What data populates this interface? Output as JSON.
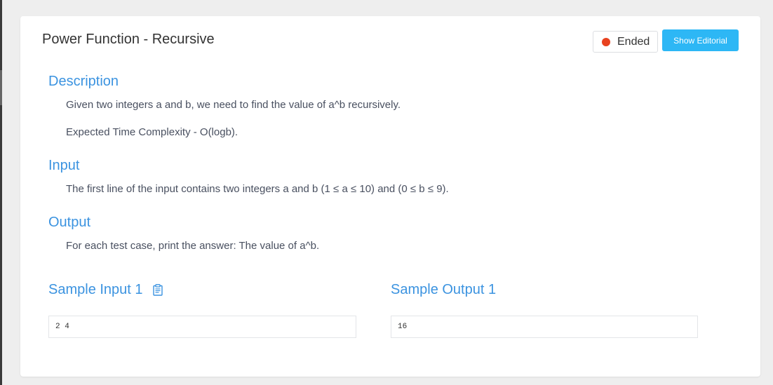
{
  "problem": {
    "title": "Power Function - Recursive",
    "status": {
      "label": "Ended",
      "color": "#e8421f"
    },
    "editorial_button": "Show Editorial"
  },
  "description": {
    "heading": "Description",
    "lines": [
      "Given two integers a and b, we need to find the value of a^b recursively.",
      "Expected Time Complexity - O(logb)."
    ]
  },
  "input": {
    "heading": "Input",
    "text": "The first line of the input contains two integers a and b (1 ≤ a ≤ 10) and (0 ≤ b ≤ 9)."
  },
  "output": {
    "heading": "Output",
    "text": "For each test case, print the answer: The value of a^b."
  },
  "samples": {
    "input_heading": "Sample Input 1",
    "input_value": "2 4",
    "input_copy_icon": "clipboard-icon",
    "output_heading": "Sample Output 1",
    "output_value": "16"
  },
  "colors": {
    "accent": "#3b93e0",
    "button": "#2db7f5",
    "status_dot": "#e8421f"
  }
}
